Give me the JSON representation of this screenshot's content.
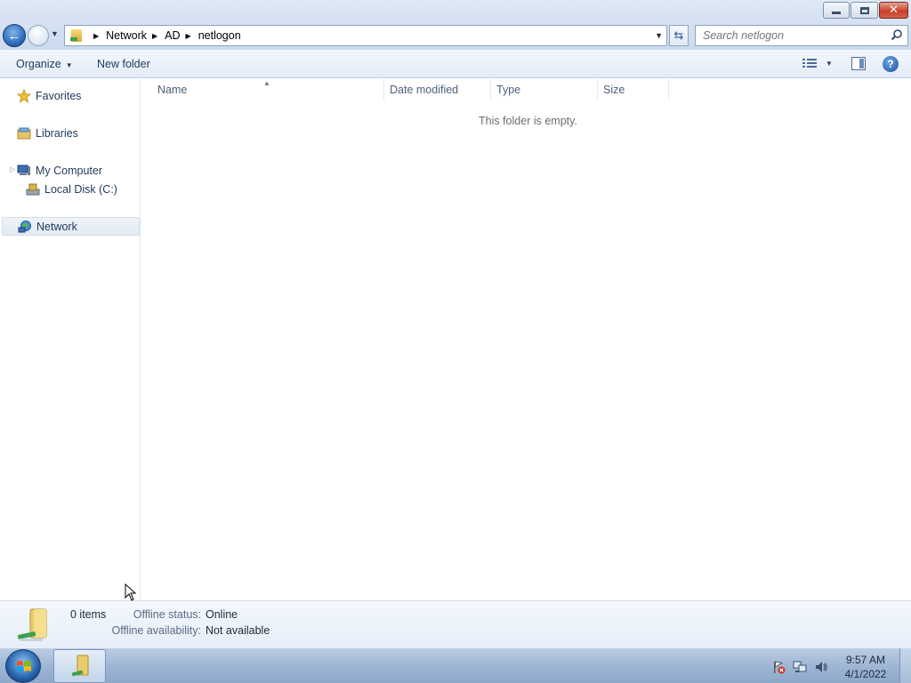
{
  "window": {
    "minimize_glyph": "minimize",
    "maximize_glyph": "restore",
    "close_glyph": "✕"
  },
  "address": {
    "crumbs": [
      "Network",
      "AD",
      "netlogon"
    ]
  },
  "search": {
    "placeholder": "Search netlogon"
  },
  "toolbar": {
    "organize_label": "Organize",
    "new_folder_label": "New folder"
  },
  "nav": {
    "favorites": "Favorites",
    "libraries": "Libraries",
    "my_computer": "My Computer",
    "local_disk": "Local Disk (C:)",
    "network": "Network"
  },
  "columns": {
    "name": "Name",
    "date_modified": "Date modified",
    "type": "Type",
    "size": "Size"
  },
  "content": {
    "empty_message": "This folder is empty."
  },
  "details": {
    "items_count": "0 items",
    "offline_status_label": "Offline status:",
    "offline_status_value": "Online",
    "offline_availability_label": "Offline availability:",
    "offline_availability_value": "Not available"
  },
  "taskbar": {
    "time": "9:57 AM",
    "date": "4/1/2022"
  },
  "colors": {
    "accent": "#1e395b",
    "selection": "#e3eaf3",
    "taskbar": "#9fb6d4"
  }
}
